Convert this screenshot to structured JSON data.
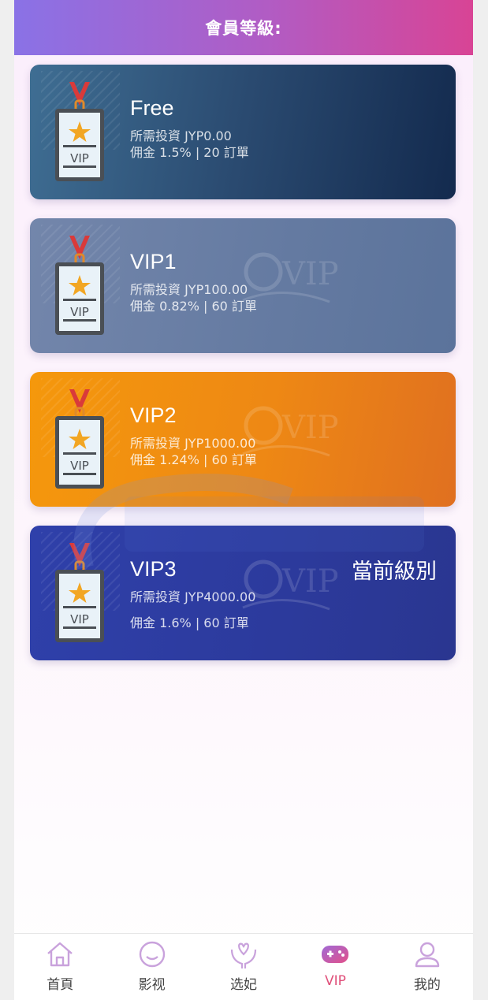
{
  "header": {
    "title": "會員等級:"
  },
  "levels": [
    {
      "name": "Free",
      "invest": "所需投資 JYP0.00",
      "commission": "佣金 1.5% | 20 訂單",
      "current": ""
    },
    {
      "name": "VIP1",
      "invest": "所需投資 JYP100.00",
      "commission": "佣金 0.82% | 60 訂單",
      "current": ""
    },
    {
      "name": "VIP2",
      "invest": "所需投資 JYP1000.00",
      "commission": "佣金 1.24% | 60 訂單",
      "current": ""
    },
    {
      "name": "VIP3",
      "invest": "所需投資 JYP4000.00",
      "commission": "佣金 1.6% | 60 訂單",
      "current": "當前級別"
    }
  ],
  "colors": {
    "free": [
      "#3f6e93",
      "#132a4e"
    ],
    "vip1": [
      "#6e82a6",
      "#5b739b"
    ],
    "vip2": [
      "#f5950e",
      "#e07020"
    ],
    "vip3": [
      "#2f3fa8",
      "#2a3690"
    ],
    "accent": "#e0507a"
  },
  "tabbar": {
    "tabs": [
      {
        "label": "首頁",
        "icon": "home-icon"
      },
      {
        "label": "影视",
        "icon": "smile-icon"
      },
      {
        "label": "选妃",
        "icon": "heart-hands-icon"
      },
      {
        "label": "VIP",
        "icon": "gamepad-icon",
        "active": true
      },
      {
        "label": "我的",
        "icon": "user-icon"
      }
    ]
  }
}
